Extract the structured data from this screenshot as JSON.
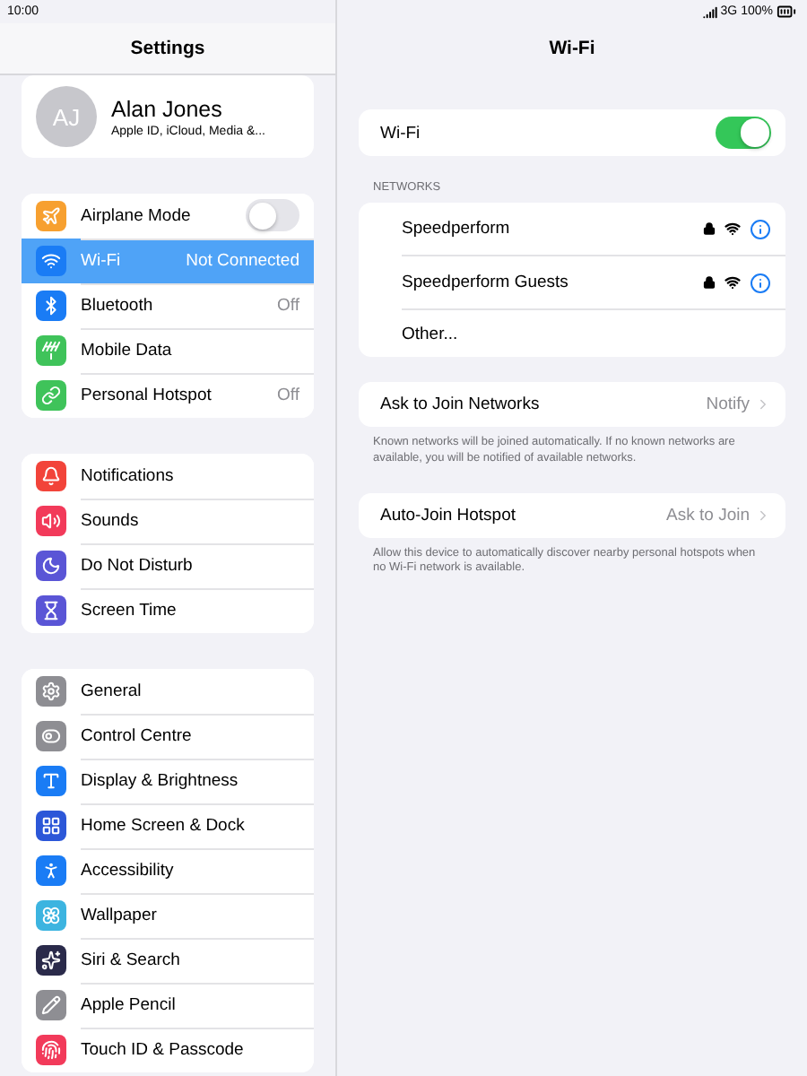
{
  "status_bar": {
    "time": "10:00",
    "network": "3G",
    "battery": "100%"
  },
  "sidebar": {
    "title": "Settings",
    "profile": {
      "initials": "AJ",
      "name": "Alan Jones",
      "subtitle": "Apple ID, iCloud, Media &..."
    },
    "groups": [
      [
        {
          "label": "Airplane Mode",
          "kind": "toggle",
          "on": false,
          "selected": false,
          "color": "#f7a030"
        },
        {
          "label": "Wi-Fi",
          "kind": "value",
          "value": "Not Connected",
          "selected": true,
          "color": "#1a7cf5"
        },
        {
          "label": "Bluetooth",
          "kind": "value",
          "value": "Off",
          "selected": false,
          "color": "#1a7cf5"
        },
        {
          "label": "Mobile Data",
          "kind": "plain",
          "selected": false,
          "color": "#3fc35a"
        },
        {
          "label": "Personal Hotspot",
          "kind": "value",
          "value": "Off",
          "selected": false,
          "color": "#3fc35a"
        }
      ],
      [
        {
          "label": "Notifications",
          "kind": "plain",
          "selected": false,
          "color": "#f2443a"
        },
        {
          "label": "Sounds",
          "kind": "plain",
          "selected": false,
          "color": "#f23a5a"
        },
        {
          "label": "Do Not Disturb",
          "kind": "plain",
          "selected": false,
          "color": "#5a55d6"
        },
        {
          "label": "Screen Time",
          "kind": "plain",
          "selected": false,
          "color": "#5a55d6"
        }
      ],
      [
        {
          "label": "General",
          "kind": "plain",
          "selected": false,
          "color": "#8e8e93"
        },
        {
          "label": "Control Centre",
          "kind": "plain",
          "selected": false,
          "color": "#8e8e93"
        },
        {
          "label": "Display & Brightness",
          "kind": "plain",
          "selected": false,
          "color": "#1a7cf5"
        },
        {
          "label": "Home Screen & Dock",
          "kind": "plain",
          "selected": false,
          "color": "#2c57d8"
        },
        {
          "label": "Accessibility",
          "kind": "plain",
          "selected": false,
          "color": "#1a7cf5"
        },
        {
          "label": "Wallpaper",
          "kind": "plain",
          "selected": false,
          "color": "#3cb4e0"
        },
        {
          "label": "Siri & Search",
          "kind": "plain",
          "selected": false,
          "color": "#2a2a4a"
        },
        {
          "label": "Apple Pencil",
          "kind": "plain",
          "selected": false,
          "color": "#8e8e93"
        },
        {
          "label": "Touch ID & Passcode",
          "kind": "plain",
          "selected": false,
          "color": "#f23a5a"
        }
      ]
    ]
  },
  "detail": {
    "title": "Wi-Fi",
    "wifi": {
      "label": "Wi-Fi",
      "on": true
    },
    "networks_header": "NETWORKS",
    "networks": [
      {
        "name": "Speedperform",
        "kind": "network"
      },
      {
        "name": "Speedperform Guests",
        "kind": "network"
      },
      {
        "name": "Other...",
        "kind": "other"
      }
    ],
    "options": [
      {
        "label": "Ask to Join Networks",
        "value": "Notify",
        "footer": "Known networks will be joined automatically. If no known networks are available, you will be notified of available networks."
      },
      {
        "label": "Auto-Join Hotspot",
        "value": "Ask to Join",
        "footer": "Allow this device to automatically discover nearby personal hotspots when no Wi-Fi network is available."
      }
    ]
  }
}
